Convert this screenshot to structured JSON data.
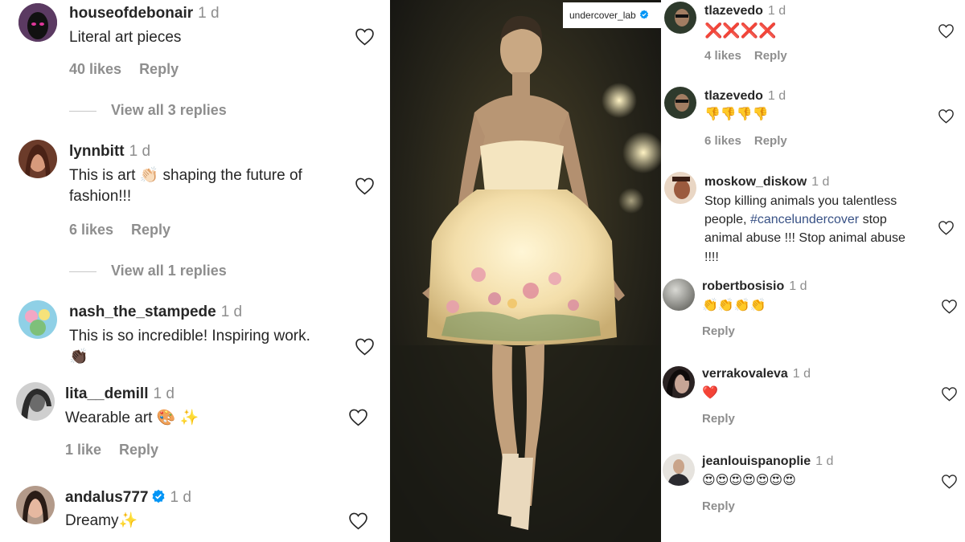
{
  "left_comments": [
    {
      "username": "houseofdebonair",
      "time": "1 d",
      "text": "Literal art pieces",
      "likes": "40 likes",
      "reply": "Reply",
      "view_replies": "View all 3 replies"
    },
    {
      "username": "lynnbitt",
      "time": "1 d",
      "text_line1": "This is art 👏🏻 shaping the future of",
      "text_line2": "fashion!!!",
      "likes": "6 likes",
      "reply": "Reply",
      "view_replies": "View all 1 replies"
    },
    {
      "username": "nash_the_stampede",
      "time": "1 d",
      "text_line1": "This is so incredible! Inspiring work.",
      "text_line2": "👏🏿"
    },
    {
      "username": "lita__demill",
      "time": "1 d",
      "text": "Wearable art 🎨 ✨",
      "likes": "1 like",
      "reply": "Reply"
    },
    {
      "username": "andalus777",
      "time": "1 d",
      "text": "Dreamy✨",
      "verified": true
    }
  ],
  "photo": {
    "account_label": "undercover_lab",
    "verified": true
  },
  "right_comments": [
    {
      "username": "tlazevedo",
      "time": "1 d",
      "text": "❌❌❌❌",
      "likes": "4 likes",
      "reply": "Reply"
    },
    {
      "username": "tlazevedo",
      "time": "1 d",
      "text": "👎👎👎👎",
      "likes": "6 likes",
      "reply": "Reply"
    },
    {
      "username": "moskow_diskow",
      "time": "1 d",
      "line1": "Stop killing animals you talentless",
      "line2_pre": "people, ",
      "hashtag": "#cancelundercover",
      "line2_post": " stop",
      "line3": "animal abuse !!! Stop animal abuse",
      "line4": "!!!!"
    },
    {
      "username": "robertbosisio",
      "time": "1 d",
      "text": "👏👏👏👏",
      "reply": "Reply"
    },
    {
      "username": "verrakovaleva",
      "time": "1 d",
      "text": "❤️",
      "reply": "Reply"
    },
    {
      "username": "jeanlouispanoplie",
      "time": "1 d",
      "text": "😍😍😍😍😍😍😍",
      "reply": "Reply"
    }
  ],
  "colors": {
    "text": "#262626",
    "muted": "#8e8e8e",
    "verified": "#0095f6",
    "hashtag": "#385185"
  },
  "icons": {
    "like": "heart-outline-icon",
    "verified": "verified-badge-icon"
  }
}
